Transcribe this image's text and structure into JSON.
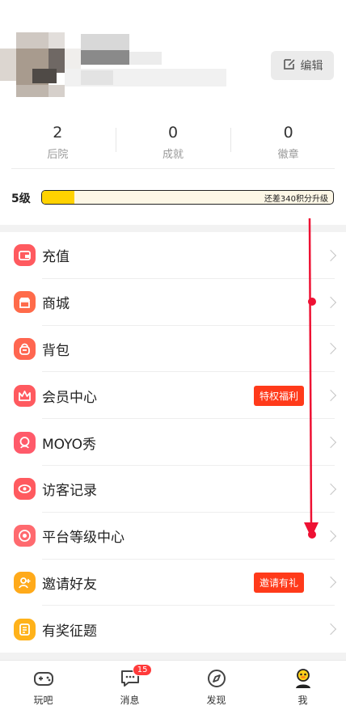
{
  "header": {
    "edit_label": "编辑"
  },
  "stats": [
    {
      "value": "2",
      "label": "后院"
    },
    {
      "value": "0",
      "label": "成就"
    },
    {
      "value": "0",
      "label": "徽章"
    }
  ],
  "level": {
    "label": "5级",
    "progress_text": "还差340积分升级",
    "progress_fraction": 0.11
  },
  "menu": [
    {
      "label": "充值",
      "icon": "wallet-icon",
      "color": "#ff5a5f",
      "badge": ""
    },
    {
      "label": "商城",
      "icon": "store-icon",
      "color": "#ff6b4a",
      "badge": ""
    },
    {
      "label": "背包",
      "icon": "backpack-icon",
      "color": "#ff6650",
      "badge": ""
    },
    {
      "label": "会员中心",
      "icon": "crown-icon",
      "color": "#ff5a5f",
      "badge": "特权福利"
    },
    {
      "label": "MOYO秀",
      "icon": "avatar-show-icon",
      "color": "#ff5a6a",
      "badge": ""
    },
    {
      "label": "访客记录",
      "icon": "eye-icon",
      "color": "#ff5a5f",
      "badge": ""
    },
    {
      "label": "平台等级中心",
      "icon": "level-target-icon",
      "color": "#ff6a6f",
      "badge": ""
    },
    {
      "label": "邀请好友",
      "icon": "invite-friend-icon",
      "color": "#ffaa1a",
      "badge": "邀请有礼"
    },
    {
      "label": "有奖征题",
      "icon": "document-icon",
      "color": "#ffb21a",
      "badge": ""
    }
  ],
  "tabs": [
    {
      "label": "玩吧",
      "icon": "gamepad-icon",
      "badge": ""
    },
    {
      "label": "消息",
      "icon": "chat-bubble-icon",
      "badge": "15"
    },
    {
      "label": "发现",
      "icon": "compass-icon",
      "badge": ""
    },
    {
      "label": "我",
      "icon": "profile-duck-icon",
      "badge": ""
    }
  ],
  "colors": {
    "accent": "#ff3a1a",
    "level_fill": "#ffd200",
    "annotation": "#ee1133"
  }
}
